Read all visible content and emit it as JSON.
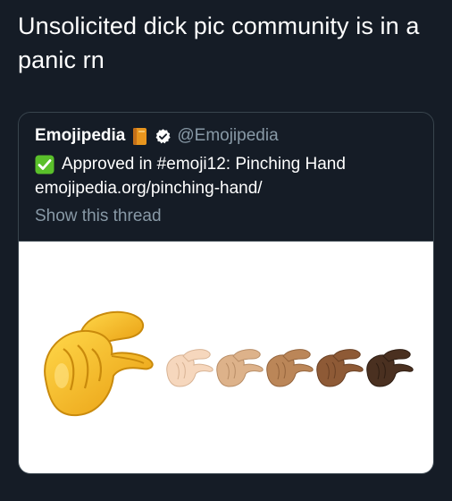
{
  "post": {
    "text": "Unsolicited dick pic community is in a panic rn"
  },
  "quote": {
    "author_name": "Emojipedia",
    "handle": "@Emojipedia",
    "line1": "Approved in #emoji12: Pinching Hand",
    "line2": "emojipedia.org/pinching-hand/",
    "show_thread": "Show this thread",
    "icons": [
      "book-icon",
      "verified-icon",
      "check-mark-button-icon"
    ]
  },
  "media": {
    "skin_tones": [
      "default-yellow",
      "light",
      "medium-light",
      "medium",
      "medium-dark",
      "dark"
    ]
  },
  "colors": {
    "background": "#151c26",
    "text_primary": "#ffffff",
    "text_secondary": "#8899a6",
    "card_border": "#38444d",
    "check_green": "#5ac02b",
    "hand_yellow": "#f7c01d",
    "tone_light": "#f6d7bd",
    "tone_medium_light": "#ddb28a",
    "tone_medium": "#bb8658",
    "tone_medium_dark": "#8e5a36",
    "tone_dark": "#4a3020"
  }
}
